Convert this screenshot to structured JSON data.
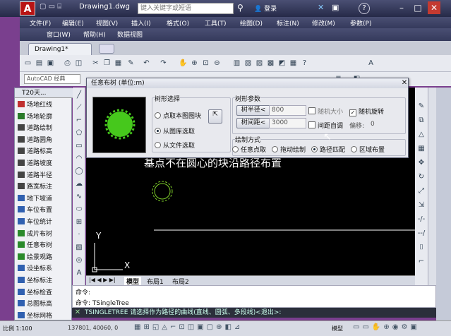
{
  "app": {
    "logo": "A",
    "doc_title": "Drawing1.dwg",
    "search_placeholder": "键入关键字或短语",
    "login_label": "登录"
  },
  "menu1": [
    "文件(F)",
    "编辑(E)",
    "视图(V)",
    "插入(I)",
    "格式(O)",
    "工具(T)",
    "绘图(D)",
    "标注(N)",
    "修改(M)",
    "参数(P)"
  ],
  "menu2": [
    "窗口(W)",
    "帮助(H)",
    "数据视图"
  ],
  "doc_tab": "Drawing1*",
  "workspace": "AutoCAD 经典",
  "t20": {
    "title": "T20天...",
    "items": [
      {
        "label": "场地红线",
        "color": "#c03030"
      },
      {
        "label": "场地轮廓",
        "color": "#2a7a2a"
      },
      {
        "label": "道路绘制",
        "color": "#444"
      },
      {
        "label": "道路圆角",
        "color": "#444"
      },
      {
        "label": "道路标高",
        "color": "#444"
      },
      {
        "label": "道路坡度",
        "color": "#444"
      },
      {
        "label": "道路半径",
        "color": "#444"
      },
      {
        "label": "路宽标注",
        "color": "#444"
      },
      {
        "label": "地下坡道",
        "color": "#3060b0"
      },
      {
        "label": "车位布置",
        "color": "#3060b0"
      },
      {
        "label": "车位统计",
        "color": "#3060b0"
      },
      {
        "label": "成片布树",
        "color": "#2a8a2a"
      },
      {
        "label": "任意布树",
        "color": "#2a8a2a"
      },
      {
        "label": "绘景观路",
        "color": "#2a8a2a"
      },
      {
        "label": "设坐标系",
        "color": "#3060b0"
      },
      {
        "label": "坐标标注",
        "color": "#3060b0"
      },
      {
        "label": "坐标检查",
        "color": "#3060b0"
      },
      {
        "label": "总图标高",
        "color": "#3060b0"
      },
      {
        "label": "坐标网格",
        "color": "#3060b0"
      }
    ]
  },
  "dialog": {
    "title": "任意布树 (单位:m)",
    "group_select": "树形选择",
    "opt_pick": "点取本图图块",
    "opt_lib": "从图库选取",
    "opt_file": "从文件选取",
    "group_params": "树形参数",
    "radius_btn": "树半径<",
    "radius_val": "800",
    "spacing_btn": "树间距<",
    "spacing_val": "3000",
    "random_size": "随机大小",
    "random_rotate": "随机旋转",
    "auto_adjust": "间距自调",
    "offset_label": "偏移:",
    "offset_val": "0",
    "group_mode": "绘制方式",
    "mode_pick": "任意点取",
    "mode_drag": "拖动绘制",
    "mode_path": "路径匹配",
    "mode_area": "区域布置"
  },
  "canvas_note": "基点不在圆心的块沿路径布置",
  "layout_tabs": [
    "模型",
    "布局1",
    "布局2"
  ],
  "command_history": [
    "命令:",
    "命令: TSingleTree"
  ],
  "command_prompt": "TSINGLETREE 请选择作为路径的曲线(直线、圆弧、多段线)<退出>:",
  "status": {
    "scale": "比例 1:100",
    "coords": "137801, 40060, 0",
    "model": "模型"
  }
}
